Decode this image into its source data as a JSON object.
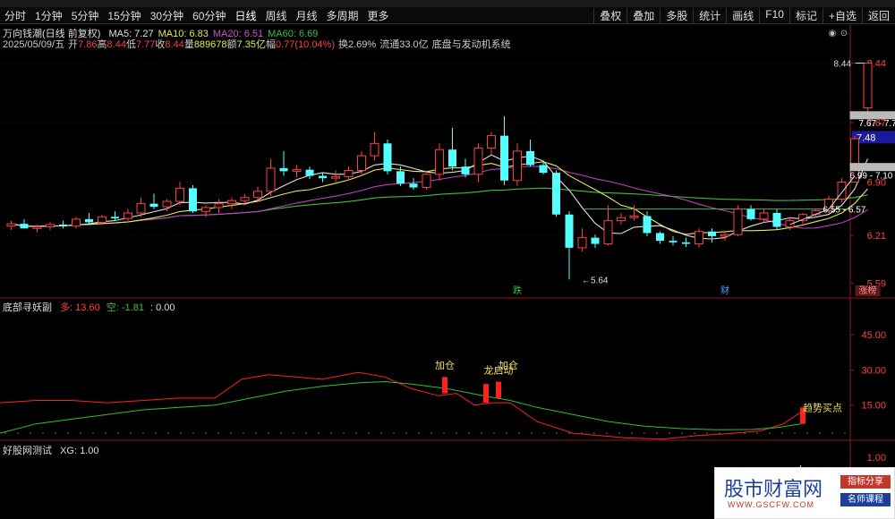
{
  "toolbar": {
    "periods": [
      "分时",
      "1分钟",
      "5分钟",
      "15分钟",
      "30分钟",
      "60分钟",
      "日线",
      "周线",
      "月线",
      "多周期",
      "更多"
    ],
    "active_period": "日线",
    "right_buttons": [
      "叠权",
      "叠加",
      "多股",
      "统计",
      "画线",
      "F10",
      "标记",
      "+自选",
      "返回"
    ]
  },
  "main": {
    "title": "万向钱潮(日线 前复权)",
    "ma_items": [
      {
        "label": "MA5: 7.27",
        "color": "#e0e0e0"
      },
      {
        "label": "MA10: 6.83",
        "color": "#e8e85a"
      },
      {
        "label": "MA20: 6.51",
        "color": "#d050d0"
      },
      {
        "label": "MA60: 6.69",
        "color": "#3fbf3f"
      }
    ],
    "info_items": [
      {
        "text": "2025/05/09/五",
        "color": "#cccccc"
      },
      {
        "text": "开",
        "color": "#cccccc"
      },
      {
        "text": "7.86",
        "color": "#ff4040"
      },
      {
        "text": "高",
        "color": "#cccccc"
      },
      {
        "text": "8.44",
        "color": "#ff4040"
      },
      {
        "text": "低",
        "color": "#cccccc"
      },
      {
        "text": "7.77",
        "color": "#ff4040"
      },
      {
        "text": "收",
        "color": "#cccccc"
      },
      {
        "text": "8.44",
        "color": "#ff4040"
      },
      {
        "text": "量",
        "color": "#cccccc"
      },
      {
        "text": "889678",
        "color": "#e8e85a"
      },
      {
        "text": "额",
        "color": "#cccccc"
      },
      {
        "text": "7.35亿",
        "color": "#e8e85a"
      },
      {
        "text": "幅",
        "color": "#cccccc"
      },
      {
        "text": "0.77(10.04%)",
        "color": "#ff4040"
      },
      {
        "text": "换2.69%",
        "color": "#cccccc"
      },
      {
        "text": "流通33.0亿",
        "color": "#cccccc"
      },
      {
        "text": "底盘与发动机系统",
        "color": "#cccccc"
      }
    ],
    "price_axis": [
      "8.44",
      "7.67",
      "7.48",
      "6.90",
      "6.21",
      "5.59"
    ],
    "annotations": {
      "high": "8.44",
      "low": "5.64",
      "zone1": "7.67 - 7.77",
      "zone2": "6.99 - 7.10",
      "zone3": "6.55 - 6.57"
    },
    "markers": {
      "die": "跌",
      "cai": "财",
      "zhang": "涨榜"
    },
    "last_price_tag": "7.48"
  },
  "panel2": {
    "name": "底部寻妖副",
    "duo_label": "多: 13.60",
    "kong_label": "空: -1.81",
    "zero_label": ": 0.00",
    "axis": [
      "45.00",
      "30.00",
      "15.00"
    ],
    "signals": [
      "加仓",
      "龙启动",
      "加仓",
      "趋势买点"
    ]
  },
  "panel3": {
    "name": "好股网测试",
    "xg_label": "XG: 1.00",
    "axis": [
      "1.00"
    ]
  },
  "watermark": {
    "main": "股市财富网",
    "url": "WWW.GSCFW.COM",
    "tag1": "指标分享",
    "tag2": "名师课程"
  },
  "chart_data": {
    "type": "candlestick",
    "candles": [
      {
        "o": 6.33,
        "h": 6.4,
        "l": 6.28,
        "c": 6.36
      },
      {
        "o": 6.36,
        "h": 6.42,
        "l": 6.3,
        "c": 6.3
      },
      {
        "o": 6.3,
        "h": 6.35,
        "l": 6.25,
        "c": 6.32
      },
      {
        "o": 6.32,
        "h": 6.38,
        "l": 6.28,
        "c": 6.35
      },
      {
        "o": 6.35,
        "h": 6.4,
        "l": 6.3,
        "c": 6.33
      },
      {
        "o": 6.33,
        "h": 6.45,
        "l": 6.3,
        "c": 6.42
      },
      {
        "o": 6.42,
        "h": 6.5,
        "l": 6.36,
        "c": 6.38
      },
      {
        "o": 6.38,
        "h": 6.48,
        "l": 6.35,
        "c": 6.45
      },
      {
        "o": 6.45,
        "h": 6.52,
        "l": 6.4,
        "c": 6.43
      },
      {
        "o": 6.43,
        "h": 6.55,
        "l": 6.4,
        "c": 6.5
      },
      {
        "o": 6.5,
        "h": 6.7,
        "l": 6.45,
        "c": 6.62
      },
      {
        "o": 6.62,
        "h": 6.75,
        "l": 6.55,
        "c": 6.58
      },
      {
        "o": 6.58,
        "h": 6.68,
        "l": 6.52,
        "c": 6.65
      },
      {
        "o": 6.65,
        "h": 6.9,
        "l": 6.6,
        "c": 6.82
      },
      {
        "o": 6.82,
        "h": 6.86,
        "l": 6.5,
        "c": 6.52
      },
      {
        "o": 6.52,
        "h": 6.6,
        "l": 6.45,
        "c": 6.57
      },
      {
        "o": 6.57,
        "h": 6.68,
        "l": 6.5,
        "c": 6.62
      },
      {
        "o": 6.62,
        "h": 6.7,
        "l": 6.55,
        "c": 6.66
      },
      {
        "o": 6.66,
        "h": 6.74,
        "l": 6.6,
        "c": 6.7
      },
      {
        "o": 6.7,
        "h": 6.84,
        "l": 6.65,
        "c": 6.78
      },
      {
        "o": 6.78,
        "h": 7.2,
        "l": 6.72,
        "c": 7.08
      },
      {
        "o": 7.08,
        "h": 7.3,
        "l": 6.98,
        "c": 7.04
      },
      {
        "o": 7.04,
        "h": 7.12,
        "l": 6.96,
        "c": 7.06
      },
      {
        "o": 7.06,
        "h": 7.1,
        "l": 6.94,
        "c": 6.98
      },
      {
        "o": 6.98,
        "h": 7.02,
        "l": 6.9,
        "c": 6.95
      },
      {
        "o": 6.95,
        "h": 7.05,
        "l": 6.9,
        "c": 6.97
      },
      {
        "o": 6.97,
        "h": 7.1,
        "l": 6.92,
        "c": 7.05
      },
      {
        "o": 7.05,
        "h": 7.3,
        "l": 7.0,
        "c": 7.24
      },
      {
        "o": 7.24,
        "h": 7.55,
        "l": 7.18,
        "c": 7.4
      },
      {
        "o": 7.4,
        "h": 7.45,
        "l": 7.0,
        "c": 7.04
      },
      {
        "o": 7.04,
        "h": 7.1,
        "l": 6.85,
        "c": 6.88
      },
      {
        "o": 6.88,
        "h": 6.95,
        "l": 6.8,
        "c": 6.83
      },
      {
        "o": 6.83,
        "h": 7.05,
        "l": 6.8,
        "c": 7.0
      },
      {
        "o": 7.0,
        "h": 7.4,
        "l": 6.92,
        "c": 7.32
      },
      {
        "o": 7.32,
        "h": 7.6,
        "l": 7.05,
        "c": 7.1
      },
      {
        "o": 7.1,
        "h": 7.2,
        "l": 6.96,
        "c": 7.0
      },
      {
        "o": 7.0,
        "h": 7.4,
        "l": 6.9,
        "c": 7.34
      },
      {
        "o": 7.34,
        "h": 7.55,
        "l": 7.25,
        "c": 7.5
      },
      {
        "o": 7.5,
        "h": 7.75,
        "l": 6.86,
        "c": 6.92
      },
      {
        "o": 6.92,
        "h": 7.4,
        "l": 6.85,
        "c": 7.3
      },
      {
        "o": 7.3,
        "h": 7.45,
        "l": 7.1,
        "c": 7.12
      },
      {
        "o": 7.12,
        "h": 7.18,
        "l": 7.0,
        "c": 7.02
      },
      {
        "o": 7.02,
        "h": 7.05,
        "l": 6.45,
        "c": 6.48
      },
      {
        "o": 6.48,
        "h": 6.52,
        "l": 5.64,
        "c": 6.05
      },
      {
        "o": 6.05,
        "h": 6.3,
        "l": 6.0,
        "c": 6.18
      },
      {
        "o": 6.18,
        "h": 6.22,
        "l": 6.05,
        "c": 6.1
      },
      {
        "o": 6.1,
        "h": 6.6,
        "l": 6.08,
        "c": 6.4
      },
      {
        "o": 6.4,
        "h": 6.5,
        "l": 6.35,
        "c": 6.44
      },
      {
        "o": 6.44,
        "h": 6.6,
        "l": 6.4,
        "c": 6.46
      },
      {
        "o": 6.46,
        "h": 6.52,
        "l": 6.2,
        "c": 6.24
      },
      {
        "o": 6.24,
        "h": 6.26,
        "l": 6.1,
        "c": 6.14
      },
      {
        "o": 6.14,
        "h": 6.2,
        "l": 6.08,
        "c": 6.12
      },
      {
        "o": 6.12,
        "h": 6.18,
        "l": 6.06,
        "c": 6.1
      },
      {
        "o": 6.1,
        "h": 6.3,
        "l": 6.05,
        "c": 6.26
      },
      {
        "o": 6.26,
        "h": 6.3,
        "l": 6.12,
        "c": 6.2
      },
      {
        "o": 6.2,
        "h": 6.26,
        "l": 6.14,
        "c": 6.22
      },
      {
        "o": 6.22,
        "h": 6.6,
        "l": 6.2,
        "c": 6.55
      },
      {
        "o": 6.55,
        "h": 6.6,
        "l": 6.4,
        "c": 6.42
      },
      {
        "o": 6.42,
        "h": 6.55,
        "l": 6.38,
        "c": 6.5
      },
      {
        "o": 6.5,
        "h": 6.55,
        "l": 6.28,
        "c": 6.32
      },
      {
        "o": 6.32,
        "h": 6.45,
        "l": 6.28,
        "c": 6.4
      },
      {
        "o": 6.4,
        "h": 6.5,
        "l": 6.36,
        "c": 6.48
      },
      {
        "o": 6.48,
        "h": 6.56,
        "l": 6.44,
        "c": 6.53
      },
      {
        "o": 6.53,
        "h": 6.72,
        "l": 6.5,
        "c": 6.68
      },
      {
        "o": 6.68,
        "h": 6.95,
        "l": 6.64,
        "c": 6.9
      },
      {
        "o": 6.9,
        "h": 7.5,
        "l": 6.9,
        "c": 7.46
      },
      {
        "o": 7.86,
        "h": 8.44,
        "l": 7.77,
        "c": 8.44
      }
    ],
    "price_range": [
      5.4,
      8.7
    ],
    "ma_lines": [
      "MA5",
      "MA10",
      "MA20",
      "MA60"
    ],
    "indicator_axis": [
      0,
      55
    ]
  }
}
